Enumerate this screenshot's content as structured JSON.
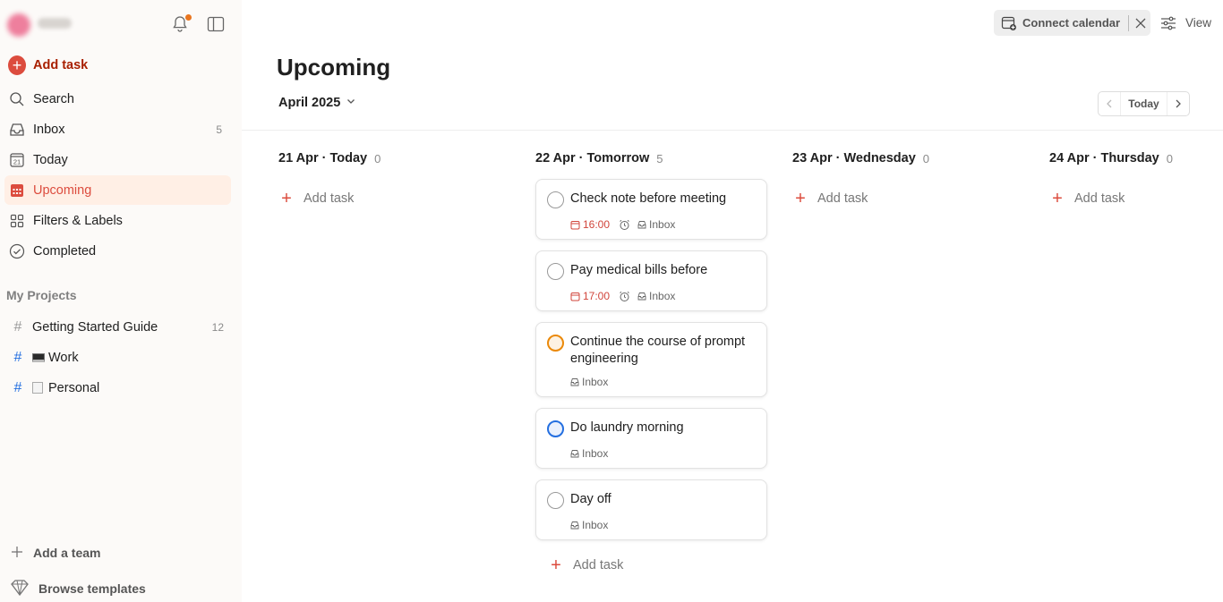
{
  "sidebar": {
    "add_task_label": "Add task",
    "nav": [
      {
        "label": "Search",
        "icon": "search-icon",
        "count": ""
      },
      {
        "label": "Inbox",
        "icon": "inbox-icon",
        "count": "5"
      },
      {
        "label": "Today",
        "icon": "calendar-today-icon",
        "count": "",
        "day": "21"
      },
      {
        "label": "Upcoming",
        "icon": "calendar-grid-icon",
        "count": "",
        "active": true
      },
      {
        "label": "Filters & Labels",
        "icon": "grid-icon",
        "count": ""
      },
      {
        "label": "Completed",
        "icon": "check-circle-icon",
        "count": ""
      }
    ],
    "projects_heading": "My Projects",
    "projects": [
      {
        "label": "Getting Started Guide",
        "count": "12"
      },
      {
        "label": "Work",
        "count": "",
        "emoji": "laptop"
      },
      {
        "label": "Personal",
        "count": "",
        "emoji": "memo"
      }
    ],
    "add_team_label": "Add a team",
    "browse_templates_label": "Browse templates"
  },
  "topbar": {
    "connect_calendar_label": "Connect calendar",
    "view_label": "View"
  },
  "page": {
    "title": "Upcoming",
    "month": "April 2025",
    "today_button": "Today"
  },
  "columns": [
    {
      "date": "21 Apr · Today",
      "count": "0",
      "add_label": "Add task"
    },
    {
      "date": "22 Apr · Tomorrow",
      "count": "5",
      "add_label": "Add task"
    },
    {
      "date": "23 Apr · Wednesday",
      "count": "0",
      "add_label": "Add task"
    },
    {
      "date": "24 Apr · Thursday",
      "count": "0",
      "add_label": "Add task"
    }
  ],
  "tasks": [
    {
      "title": "Check note before meeting",
      "time": "16:00",
      "alarm": true,
      "project": "Inbox",
      "priority_color": "#999999"
    },
    {
      "title": "Pay medical bills before",
      "time": "17:00",
      "alarm": true,
      "project": "Inbox",
      "priority_color": "#999999"
    },
    {
      "title": "Continue the course of prompt engineering",
      "time": "",
      "alarm": false,
      "project": "Inbox",
      "priority_color": "#eb8909"
    },
    {
      "title": "Do laundry morning",
      "time": "",
      "alarm": false,
      "project": "Inbox",
      "priority_color": "#246fe0"
    },
    {
      "title": "Day off",
      "time": "",
      "alarm": false,
      "project": "Inbox",
      "priority_color": "#999999"
    }
  ],
  "colors": {
    "accent": "#dc4c3e",
    "active_bg": "#ffefe5",
    "sidebar_bg": "#fcfaf8",
    "notification_dot": "#e9751e"
  }
}
